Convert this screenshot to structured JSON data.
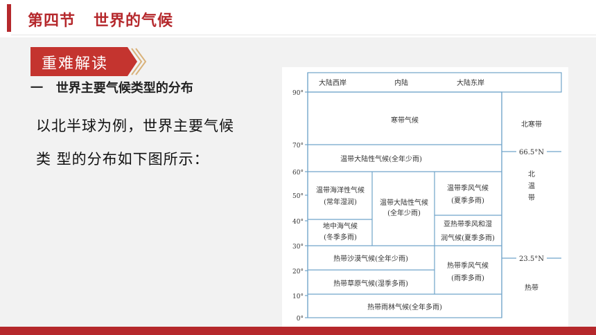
{
  "header": {
    "title": "第四节   世界的气候"
  },
  "badge": {
    "label": "重难解读"
  },
  "section": {
    "heading": "一   世界主要气候类型的分布"
  },
  "body": {
    "line1": "以北半球为例，世界主要气候",
    "line2": "类 型的分布如下图所示："
  },
  "figure": {
    "columns": [
      "大陆西岸",
      "内陆",
      "大陆东岸"
    ],
    "lat_labels": [
      "90°",
      "70°",
      "60°",
      "50°",
      "40°",
      "30°",
      "20°",
      "10°",
      "0°"
    ],
    "climates": {
      "polar": "寒带气候",
      "subarctic": "温带大陆性气候(全年少雨)",
      "maritime_1": "温带海洋性气候",
      "maritime_2": "(常年湿润)",
      "continental_1": "温带大陆性气候",
      "continental_2": "(全年少雨)",
      "temperate_monsoon_1": "温带季风气候",
      "temperate_monsoon_2": "(夏季多雨)",
      "mediterranean_1": "地中海气候",
      "mediterranean_2": "(冬季多雨)",
      "subtropical_monsoon_1": "亚热带季风和湿",
      "subtropical_monsoon_2": "润气候(夏季多雨)",
      "desert": "热带沙漠气候(全年少雨)",
      "savanna": "热带草原气候(湿季多雨)",
      "tropical_monsoon_1": "热带季风气候",
      "tropical_monsoon_2": "(雨季多雨)",
      "rainforest": "热带雨林气候(全年多雨)"
    },
    "zones": {
      "north_frigid": "北寒带",
      "arctic_circle": "66.5°N",
      "temperate_1": "北",
      "temperate_2": "温",
      "temperate_3": "带",
      "tropic": "23.5°N",
      "tropical": "热带"
    }
  },
  "colors": {
    "accent": "#b5282c",
    "badge": "#c4342f",
    "grid": "#6fa3c9"
  }
}
